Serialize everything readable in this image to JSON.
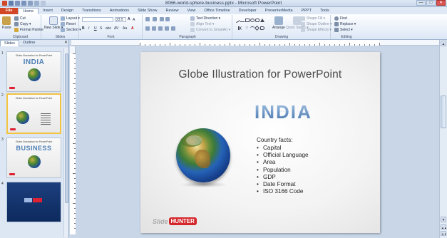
{
  "window": {
    "title": "8066-world-sphere-business.pptx - Microsoft PowerPoint",
    "controls": [
      "—",
      "□",
      "✕"
    ]
  },
  "tabs": [
    "File",
    "Home",
    "Insert",
    "Design",
    "Transitions",
    "Animations",
    "Slide Show",
    "Review",
    "View",
    "Office Timeline",
    "Developer",
    "PresenterMedia",
    "PPPT",
    "Tools"
  ],
  "ribbon": {
    "clipboard": {
      "label": "Clipboard",
      "paste": "Paste",
      "cut": "Cut",
      "copy": "Copy ▾",
      "format_painter": "Format Painter"
    },
    "slides": {
      "label": "Slides",
      "new_slide": "New Slide ▾",
      "layout": "Layout ▾",
      "reset": "Reset",
      "section": "Section ▾"
    },
    "font": {
      "label": "Font",
      "font_size": "23.5",
      "buttons": [
        "B",
        "I",
        "U",
        "S",
        "abc",
        "AV",
        "Aa",
        "A"
      ]
    },
    "paragraph": {
      "label": "Paragraph",
      "text_direction": "Text Direction ▾",
      "align_text": "Align Text ▾",
      "convert_smartart": "Convert to SmartArt ▾"
    },
    "drawing": {
      "label": "Drawing",
      "arrange": "Arrange",
      "quick_styles": "Quick Styles ▾",
      "shape_fill": "Shape Fill ▾",
      "shape_outline": "Shape Outline ▾",
      "shape_effects": "Shape Effects ▾"
    },
    "editing": {
      "label": "Editing",
      "find": "Find",
      "replace": "Replace ▾",
      "select": "Select ▾"
    }
  },
  "pane": {
    "tabs": [
      "Slides",
      "Outline"
    ],
    "close": "✕",
    "thumbnails": [
      {
        "num": "1",
        "title": "Globe Illustration for PowerPoint",
        "big": "INDIA"
      },
      {
        "num": "2",
        "title": "Globe Illustration for PowerPoint",
        "big": ""
      },
      {
        "num": "3",
        "title": "Globe Illustration for PowerPoint",
        "big": "BUSINESS"
      },
      {
        "num": "4",
        "title": "",
        "big": ""
      }
    ]
  },
  "slide": {
    "title": "Globe Illustration for PowerPoint",
    "country": "INDIA",
    "facts_heading": "Country facts:",
    "facts": [
      "Capital",
      "Official Language",
      "Area",
      "Population",
      "GDP",
      "Date Format",
      "ISO 3166 Code"
    ],
    "brand_a": "Slide",
    "brand_b": "HUNTER"
  },
  "scrollbar": {
    "up": "▲",
    "down": "▼",
    "prev_slide": "▲▲",
    "next_slide": "▼▼"
  },
  "colors": {
    "file_tab": "#d24726",
    "accent_blue": "#4d7fb5",
    "selection": "#f3c341",
    "brand_red": "#d4262b"
  },
  "icons": [
    "save-icon",
    "undo-icon",
    "redo-icon",
    "paste-icon",
    "cut-icon",
    "copy-icon",
    "format-painter-icon",
    "new-slide-icon",
    "find-icon",
    "replace-icon",
    "select-icon",
    "arrange-icon",
    "quick-styles-icon"
  ]
}
